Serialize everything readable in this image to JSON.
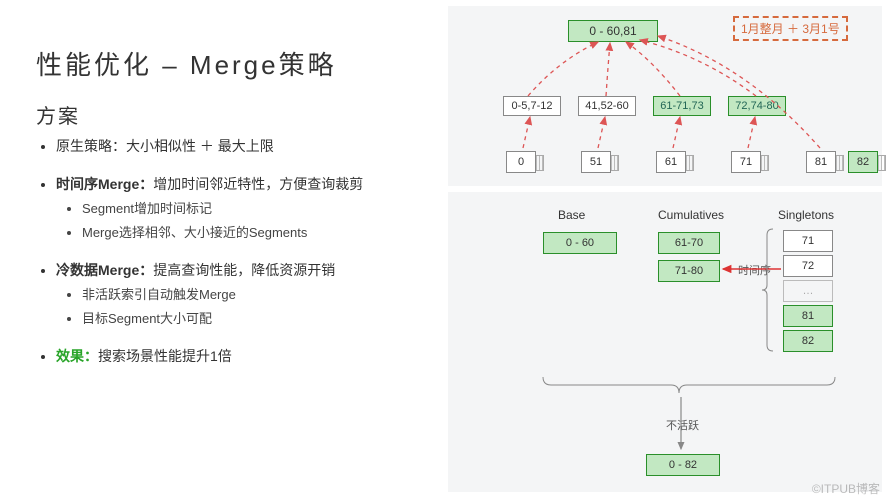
{
  "title": "性能优化 – Merge策略",
  "section": "方案",
  "bullets": {
    "native": "原生策略：大小相似性 ＋ 最大上限",
    "time_h": "时间序Merge：",
    "time_t": "增加时间邻近特性，方便查询裁剪",
    "time_s1": "Segment增加时间标记",
    "time_s2": "Merge选择相邻、大小接近的Segments",
    "cold_h": "冷数据Merge：",
    "cold_t": "提高查询性能，降低资源开销",
    "cold_s1": "非活跃索引自动触发Merge",
    "cold_s2": "目标Segment大小可配",
    "eff_h": "效果：",
    "eff_t": "搜索场景性能提升1倍"
  },
  "diagram1": {
    "root": "0 - 60,81",
    "tag": "1月整月 ＋ 3月1号",
    "mid": [
      "0-5,7-12",
      "41,52-60",
      "61-71,73",
      "72,74-80"
    ],
    "leaves": [
      "0",
      "51",
      "61",
      "71",
      "81",
      "82"
    ]
  },
  "diagram2": {
    "cols": [
      "Base",
      "Cumulatives",
      "Singletons"
    ],
    "base": "0 - 60",
    "cumulatives": [
      "61-70",
      "71-80"
    ],
    "singletons": [
      "71",
      "72",
      "…",
      "81",
      "82"
    ],
    "time_note": "时间序",
    "inactive": "不活跃",
    "final": "0 - 82"
  },
  "watermark": "©ITPUB博客"
}
